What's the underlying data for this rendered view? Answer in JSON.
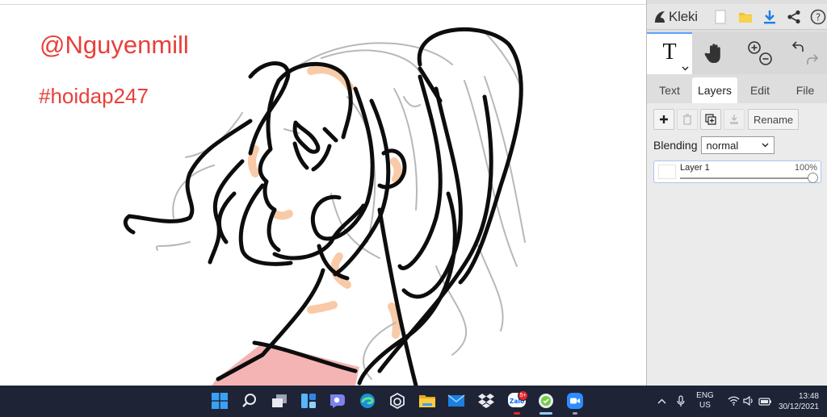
{
  "canvas": {
    "overlay_texts": {
      "user_tag": "@Nguyenmill",
      "hash_tag": "#hoidap247"
    },
    "text_color": "#e8403a"
  },
  "app": {
    "name": "Kleki",
    "top_icons": [
      "new-image-icon",
      "open-folder-icon",
      "download-icon",
      "share-icon",
      "help-icon"
    ]
  },
  "tools": {
    "items": [
      {
        "name": "text-tool",
        "label": "T",
        "active": true
      },
      {
        "name": "hand-tool",
        "active": false
      },
      {
        "name": "zoom-tool",
        "active": false
      },
      {
        "name": "undo-redo",
        "active": false
      }
    ]
  },
  "tabs": [
    {
      "label": "Text",
      "active": false
    },
    {
      "label": "Layers",
      "active": true
    },
    {
      "label": "Edit",
      "active": false
    },
    {
      "label": "File",
      "active": false
    }
  ],
  "layers": {
    "rename_label": "Rename",
    "blending_label": "Blending",
    "blending_value": "normal",
    "items": [
      {
        "name": "Layer 1",
        "opacity": "100%",
        "opacity_fraction": 1.0
      }
    ]
  },
  "taskbar": {
    "apps": [
      "windows-start",
      "search",
      "task-view",
      "widgets",
      "teams-chat",
      "edge",
      "microsoft-store",
      "file-explorer",
      "mail",
      "dropbox",
      "zalo",
      "kleki-browser",
      "zoom"
    ],
    "zalo_badge": "5+",
    "zalo_label": "Zalo",
    "language_top": "ENG",
    "language_bottom": "US",
    "time": "13:48",
    "date": "30/12/2021"
  },
  "colors": {
    "accent": "#5fa0ff",
    "taskbar": "#1e2436",
    "sidebar": "#dedede"
  }
}
